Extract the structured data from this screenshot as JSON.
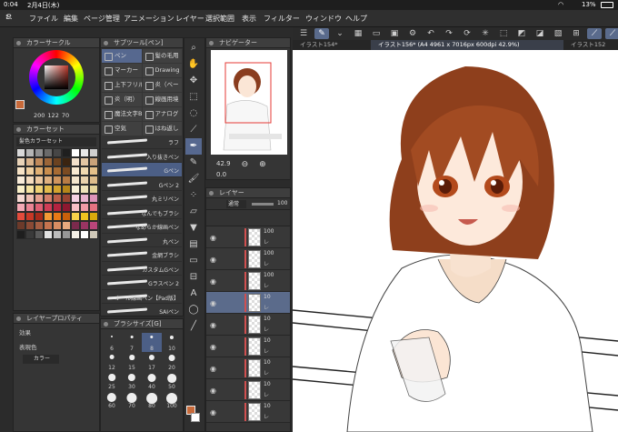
{
  "status": {
    "time": "0:04",
    "date": "2月4日(木)",
    "battery": "13%"
  },
  "menu": [
    "ファイル",
    "編集",
    "ページ管理",
    "アニメーション",
    "レイヤー",
    "選択範囲",
    "表示",
    "フィルター",
    "ウィンドウ",
    "ヘルプ"
  ],
  "panels": {
    "color_circle": "カラーサークル",
    "color_values": {
      "h": "200",
      "s": "122",
      "v": "70"
    },
    "color_set": "カラーセット",
    "color_set_name": "髪色カラーセット",
    "subtool": "サブツール[ペン]",
    "navigator": "ナビゲーター",
    "layer": "レイヤー",
    "layer_property": "レイヤープロパティ",
    "brush_size": "ブラシサイズ[G]",
    "effect_label": "効果",
    "expression_label": "表現色",
    "expression_value": "カラー",
    "blend_mode": "通常",
    "layer_opacity": "100",
    "zoom": "42.9",
    "rotation": "0.0"
  },
  "swatch_colors": [
    "#d9d9d9",
    "#b5b5b5",
    "#8f8f8f",
    "#6a6a6a",
    "#464646",
    "#1f1f1f",
    "#ffffff",
    "#e8e8e8",
    "#cfcfcf",
    "#e9d3b8",
    "#d9b38c",
    "#c0895a",
    "#9b6538",
    "#6b4220",
    "#3b2410",
    "#f2e1cc",
    "#e3c6a3",
    "#c9a27a",
    "#f7e3c6",
    "#efcfa0",
    "#e0b074",
    "#c98d4d",
    "#a76b33",
    "#7b4b22",
    "#f8ead2",
    "#f0d9b0",
    "#e4c08a",
    "#f9ecd9",
    "#f4dcbf",
    "#ecc8a0",
    "#dfb07f",
    "#cf955e",
    "#b77c45",
    "#f3e5cc",
    "#e9d2ad",
    "#ddbc8b",
    "#faf0c8",
    "#f5e3a0",
    "#eed174",
    "#e3bb4c",
    "#d3a32e",
    "#b6861a",
    "#f7f0d8",
    "#efe4bb",
    "#e5d49a",
    "#f6d9d2",
    "#efc0b5",
    "#e5a190",
    "#d47f6a",
    "#bc5f4a",
    "#9a4433",
    "#f4d1e3",
    "#eab3cf",
    "#dd92b8",
    "#f3a9b5",
    "#ea8494",
    "#de5f73",
    "#cf3d56",
    "#b42340",
    "#8e1830",
    "#f7c0c7",
    "#f09aa6",
    "#e67282",
    "#e24b3c",
    "#c83826",
    "#a82a1a",
    "#f49a35",
    "#e97a16",
    "#c9600b",
    "#f7d24a",
    "#efc21f",
    "#d9a90d",
    "#6c3a2a",
    "#8a4a35",
    "#a45d42",
    "#c4734f",
    "#d98d62",
    "#e8aa7f",
    "#7a2a4c",
    "#9a3462",
    "#b9457a",
    "#1e1e1e",
    "#3a3a3a",
    "#5a5a5a",
    "#e2e2e2",
    "#bcbcbc",
    "#969696",
    "#f5f0e6",
    "#ffffff",
    "#d0c8b8"
  ],
  "subtools": [
    {
      "label": "ペン",
      "selected": true
    },
    {
      "label": "髪の毛用",
      "selected": false
    },
    {
      "label": "マーカー",
      "selected": false
    },
    {
      "label": "Drawing",
      "selected": false
    },
    {
      "label": "上下フリル",
      "selected": false
    },
    {
      "label": "炎（ベー",
      "selected": false
    },
    {
      "label": "炎（明）",
      "selected": false
    },
    {
      "label": "線画用境",
      "selected": false
    },
    {
      "label": "魔法文字B",
      "selected": false
    },
    {
      "label": "アナログ",
      "selected": false
    },
    {
      "label": "空気",
      "selected": false
    },
    {
      "label": "はね返し",
      "selected": false
    }
  ],
  "brushes": [
    {
      "name": "ラフ",
      "selected": false
    },
    {
      "name": "入り抜きペン",
      "selected": false
    },
    {
      "name": "Gペン",
      "selected": true
    },
    {
      "name": "Gペン 2",
      "selected": false
    },
    {
      "name": "丸ミリペン",
      "selected": false
    },
    {
      "name": "なんでもブラシ",
      "selected": false
    },
    {
      "name": "なめらか線画ペン",
      "selected": false
    },
    {
      "name": "丸ペン",
      "selected": false
    },
    {
      "name": "金網ブラシ",
      "selected": false
    },
    {
      "name": "カスタムGペン",
      "selected": false
    },
    {
      "name": "Gラスペン 2",
      "selected": false
    },
    {
      "name": "オール線画ペン【Pad版】",
      "selected": false
    },
    {
      "name": "SAIペン",
      "selected": false
    }
  ],
  "brush_sizes": [
    {
      "n": "6",
      "sel": false
    },
    {
      "n": "7",
      "sel": false
    },
    {
      "n": "8",
      "sel": true
    },
    {
      "n": "10",
      "sel": false
    },
    {
      "n": "12",
      "sel": false
    },
    {
      "n": "15",
      "sel": false
    },
    {
      "n": "17",
      "sel": false
    },
    {
      "n": "20",
      "sel": false
    },
    {
      "n": "25",
      "sel": false
    },
    {
      "n": "30",
      "sel": false
    },
    {
      "n": "40",
      "sel": false
    },
    {
      "n": "50",
      "sel": false
    },
    {
      "n": "60",
      "sel": false
    },
    {
      "n": "70",
      "sel": false
    },
    {
      "n": "80",
      "sel": false
    },
    {
      "n": "100",
      "sel": false
    }
  ],
  "layers": [
    {
      "pct": "100",
      "mode": "レ",
      "sel": false
    },
    {
      "pct": "100",
      "mode": "レ",
      "sel": false
    },
    {
      "pct": "100",
      "mode": "レ",
      "sel": false
    },
    {
      "pct": "10",
      "mode": "レ",
      "sel": true
    },
    {
      "pct": "10",
      "mode": "レ",
      "sel": false
    },
    {
      "pct": "10",
      "mode": "レ",
      "sel": false
    },
    {
      "pct": "10",
      "mode": "レ",
      "sel": false
    },
    {
      "pct": "10",
      "mode": "レ",
      "sel": false
    },
    {
      "pct": "10",
      "mode": "レ",
      "sel": false
    }
  ],
  "tabs": [
    {
      "label": "イラスト154*",
      "active": false
    },
    {
      "label": "イラスト156* (A4 4961 x 7016px 600dpi 42.9%)",
      "active": true
    },
    {
      "label": "イラスト152",
      "active": false
    }
  ],
  "tool_icons": [
    "zoom",
    "hand",
    "move",
    "select",
    "lasso",
    "eyedrop",
    "pen",
    "pencil",
    "brush",
    "airbrush",
    "eraser",
    "fill",
    "gradient",
    "figure",
    "frame",
    "text",
    "balloon",
    "line"
  ]
}
